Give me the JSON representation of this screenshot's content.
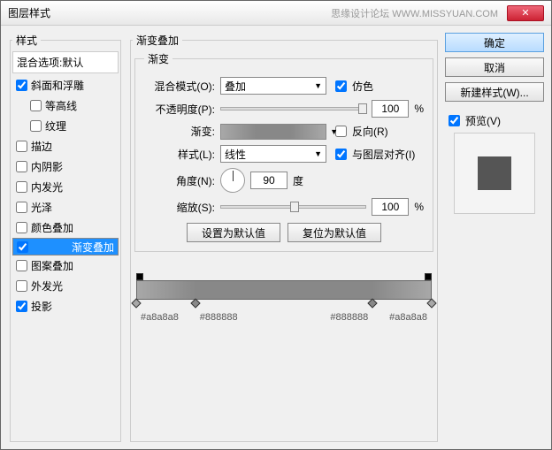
{
  "window": {
    "title": "图层样式",
    "watermark": "思缘设计论坛  WWW.MISSYUAN.COM"
  },
  "left": {
    "legend": "样式",
    "header": "混合选项:默认",
    "items": [
      {
        "label": "斜面和浮雕",
        "checked": true,
        "indent": false
      },
      {
        "label": "等高线",
        "checked": false,
        "indent": true
      },
      {
        "label": "纹理",
        "checked": false,
        "indent": true
      },
      {
        "label": "描边",
        "checked": false,
        "indent": false
      },
      {
        "label": "内阴影",
        "checked": false,
        "indent": false
      },
      {
        "label": "内发光",
        "checked": false,
        "indent": false
      },
      {
        "label": "光泽",
        "checked": false,
        "indent": false
      },
      {
        "label": "颜色叠加",
        "checked": false,
        "indent": false
      },
      {
        "label": "渐变叠加",
        "checked": true,
        "indent": false,
        "selected": true
      },
      {
        "label": "图案叠加",
        "checked": false,
        "indent": false
      },
      {
        "label": "外发光",
        "checked": false,
        "indent": false
      },
      {
        "label": "投影",
        "checked": true,
        "indent": false
      }
    ]
  },
  "center": {
    "legend": "渐变叠加",
    "inner_legend": "渐变",
    "blend_label": "混合模式(O):",
    "blend_value": "叠加",
    "dither_label": "仿色",
    "dither_checked": true,
    "opacity_label": "不透明度(P):",
    "opacity_value": "100",
    "pct": "%",
    "gradient_label": "渐变:",
    "reverse_label": "反向(R)",
    "reverse_checked": false,
    "style_label": "样式(L):",
    "style_value": "线性",
    "align_label": "与图层对齐(I)",
    "align_checked": true,
    "angle_label": "角度(N):",
    "angle_value": "90",
    "angle_unit": "度",
    "scale_label": "缩放(S):",
    "scale_value": "100",
    "default_btn": "设置为默认值",
    "reset_btn": "复位为默认值",
    "stops": [
      {
        "pos": 0,
        "color": "#a8a8a8"
      },
      {
        "pos": 20,
        "color": "#888888"
      },
      {
        "pos": 80,
        "color": "#888888"
      },
      {
        "pos": 100,
        "color": "#a8a8a8"
      }
    ]
  },
  "right": {
    "ok": "确定",
    "cancel": "取消",
    "newstyle": "新建样式(W)...",
    "preview_label": "预览(V)",
    "preview_checked": true
  }
}
